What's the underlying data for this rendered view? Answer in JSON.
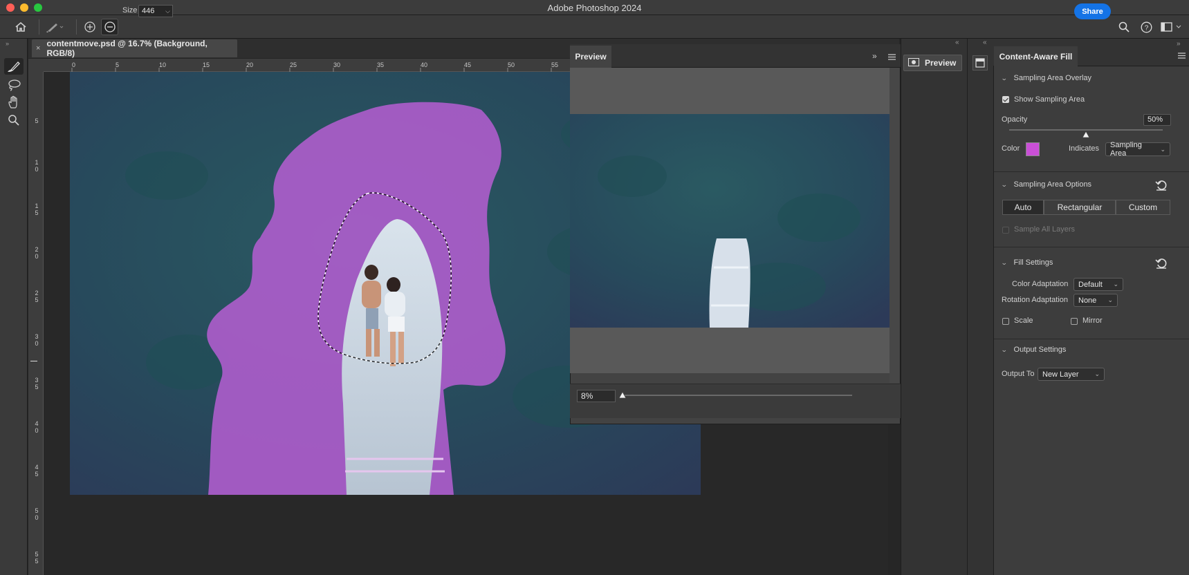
{
  "window": {
    "title": "Adobe Photoshop 2024"
  },
  "options_bar": {
    "size_label": "Size",
    "size_value": "446",
    "share_label": "Share",
    "icons": [
      "home-icon",
      "brush-icon",
      "add-mode-icon",
      "subtract-mode-icon",
      "search-icon",
      "help-icon",
      "workspace-icon"
    ]
  },
  "toolbar": {
    "tools": [
      "sampling-brush-tool-icon",
      "lasso-tool-icon",
      "hand-tool-icon",
      "zoom-tool-icon"
    ]
  },
  "document": {
    "tab_title": "contentmove.psd @ 16.7% (Background, RGB/8)",
    "close": "×"
  },
  "rulers": {
    "top_ticks": [
      "0",
      "5",
      "10",
      "15",
      "20",
      "25",
      "30",
      "35",
      "40",
      "45",
      "50",
      "55"
    ],
    "left_ticks": [
      [
        "5"
      ],
      [
        "1",
        "0"
      ],
      [
        "1",
        "5"
      ],
      [
        "2",
        "0"
      ],
      [
        "2",
        "5"
      ],
      [
        "3",
        "0"
      ],
      [
        "3",
        "5"
      ],
      [
        "4",
        "0"
      ],
      [
        "4",
        "5"
      ],
      [
        "5",
        "0"
      ],
      [
        "5",
        "5"
      ]
    ]
  },
  "preview": {
    "tab_label": "Preview",
    "zoom_value": "8%",
    "zoom_fraction": 0.0,
    "dock_button_label": "Preview"
  },
  "content_aware_fill": {
    "panel_title": "Content-Aware Fill",
    "sampling_overlay": {
      "header": "Sampling Area Overlay",
      "show_label": "Show Sampling Area",
      "show_checked": true,
      "opacity_label": "Opacity",
      "opacity_value": "50%",
      "opacity_fraction": 0.5,
      "color_label": "Color",
      "color_value": "#c94fd6",
      "indicates_label": "Indicates",
      "indicates_value": "Sampling Area"
    },
    "sampling_options": {
      "header": "Sampling Area Options",
      "modes": [
        "Auto",
        "Rectangular",
        "Custom"
      ],
      "active_mode": "Auto",
      "sample_all_label": "Sample All Layers"
    },
    "fill_settings": {
      "header": "Fill Settings",
      "color_adaptation_label": "Color Adaptation",
      "color_adaptation_value": "Default",
      "rotation_adaptation_label": "Rotation Adaptation",
      "rotation_adaptation_value": "None",
      "scale_label": "Scale",
      "mirror_label": "Mirror"
    },
    "output_settings": {
      "header": "Output Settings",
      "output_to_label": "Output To",
      "output_to_value": "New Layer"
    }
  },
  "colors": {
    "accent": "#1473e6",
    "sampling_overlay": "#b25dcf",
    "water": "#25445c"
  }
}
